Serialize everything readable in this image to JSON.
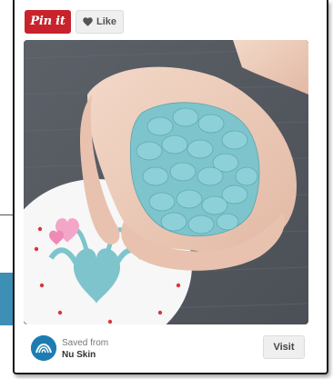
{
  "widget": {
    "pin_label": "Pin it",
    "like_label": "Like",
    "saved_from_label": "Saved from",
    "source_name": "Nu Skin",
    "visit_label": "Visit"
  },
  "icons": {
    "like": "heart-icon",
    "source": "nu-skin-logo"
  },
  "colors": {
    "pin_red": "#c8232c",
    "candy_blue": "#7ec4cc",
    "logo_blue": "#1d7db3"
  }
}
